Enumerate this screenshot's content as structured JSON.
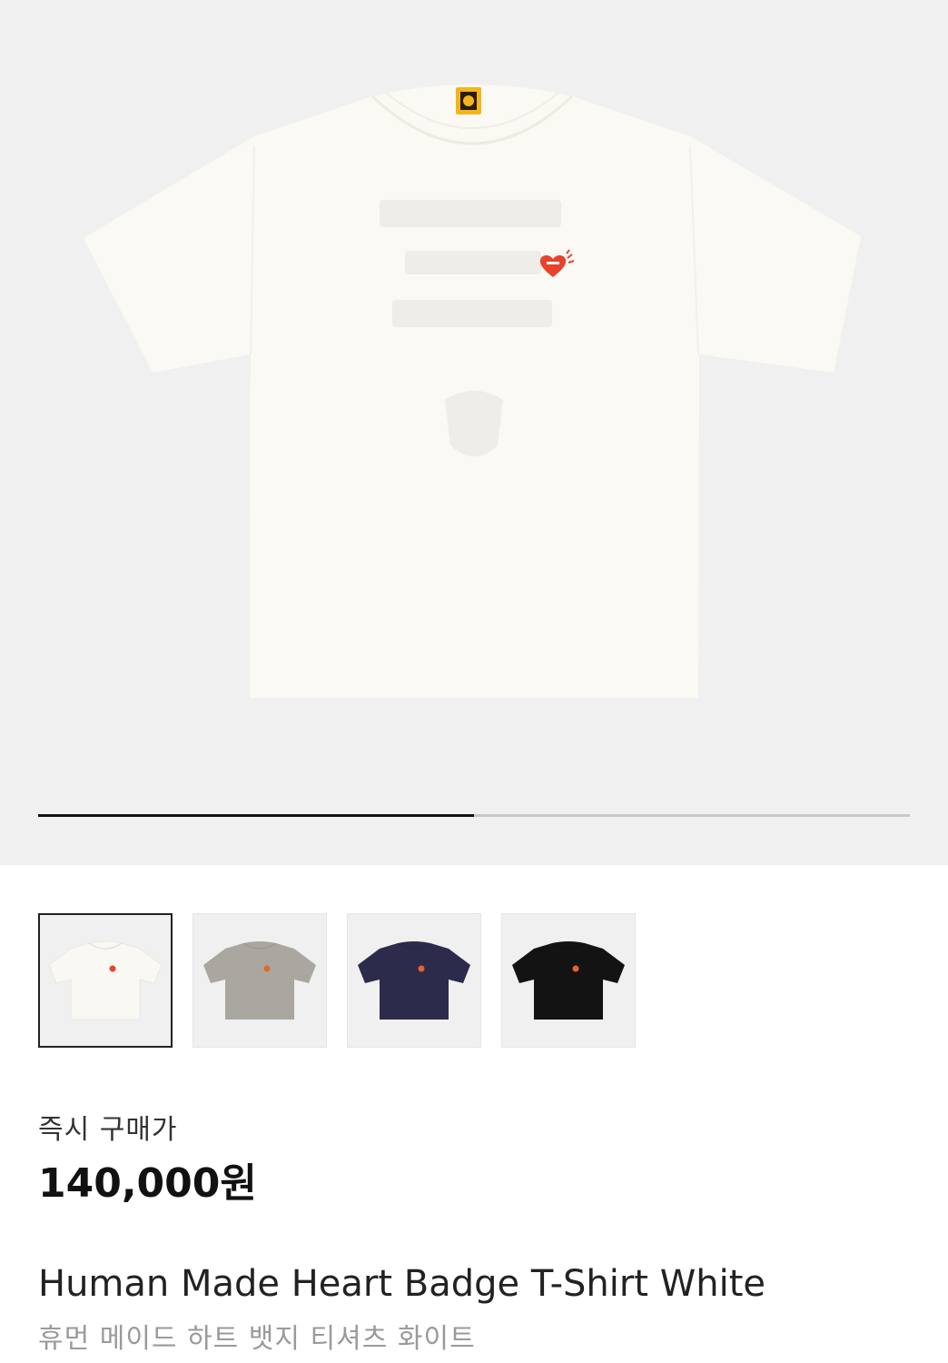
{
  "product": {
    "name_en": "Human Made Heart Badge T-Shirt White",
    "name_ko": "휴먼 메이드 하트 뱃지 티셔츠 화이트",
    "price_label": "즉시 구매가",
    "price": "140,000원"
  },
  "gallery": {
    "progress_fraction": 0.5,
    "thumbnails": [
      {
        "color": "#faf8f3",
        "selected": true,
        "heart": "#e8432c"
      },
      {
        "color": "#a9a79f",
        "selected": false,
        "heart": "#e06a2b"
      },
      {
        "color": "#2d2b4c",
        "selected": false,
        "heart": "#e8622b"
      },
      {
        "color": "#131313",
        "selected": false,
        "heart": "#e8622b"
      }
    ]
  },
  "colors": {
    "hero_background": "#f0f0f0",
    "shirt_white": "#fbf9f4",
    "heart_red": "#e8432c",
    "tag_yellow": "#f2b51c"
  }
}
